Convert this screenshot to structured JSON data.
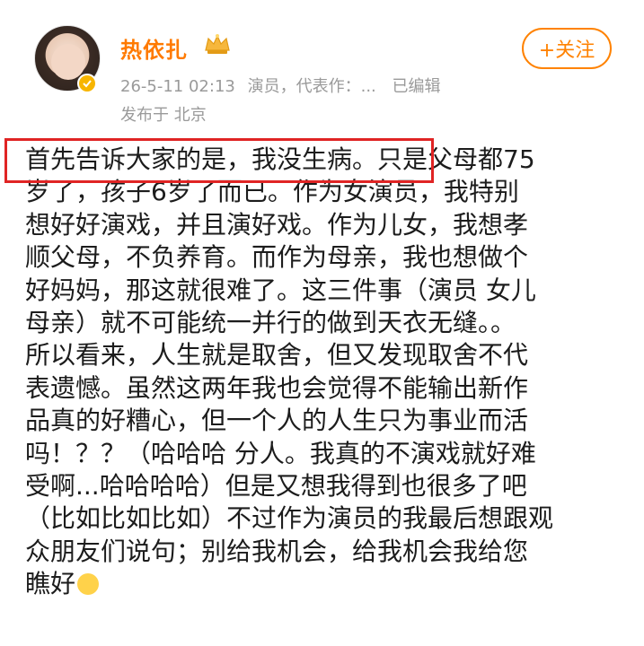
{
  "user": {
    "name": "热依扎",
    "avatar_icon": "avatar-photo",
    "verified_icon": "verified-badge-icon",
    "crown_icon": "crown-icon"
  },
  "meta": {
    "timestamp": "26-5-11 02:13",
    "role": "演员，代表作：...",
    "edited": "已编辑",
    "location": "发布于 北京"
  },
  "follow_button": {
    "label": "+关注"
  },
  "post": {
    "lines": [
      "首先告诉大家的是，我没生病。只是父母都75",
      "岁了，孩子6岁了而已。作为女演员，我特别",
      "想好好演戏，并且演好戏。作为儿女，我想孝",
      "顺父母，不负养育。而作为母亲，我也想做个",
      "好妈妈，那这就很难了。这三件事（演员 女儿",
      "母亲）就不可能统一并行的做到天衣无缝。。",
      "所以看来，人生就是取舍，但又发现取舍不代",
      "表遗憾。虽然这两年我也会觉得不能输出新作",
      "品真的好糟心，但一个人的人生只为事业而活",
      "吗！？？（哈哈哈 分人。我真的不演戏就好难",
      "受啊...哈哈哈哈）但是又想我得到也很多了吧",
      "（比如比如比如）不过作为演员的我最后想跟观",
      "众朋友们说句；别给我机会，给我机会我给您",
      "瞧好"
    ],
    "highlighted_text": "首先告诉大家的是，我没生病。",
    "highlight_color": "#e02424",
    "accent_color": "#ff8200"
  }
}
